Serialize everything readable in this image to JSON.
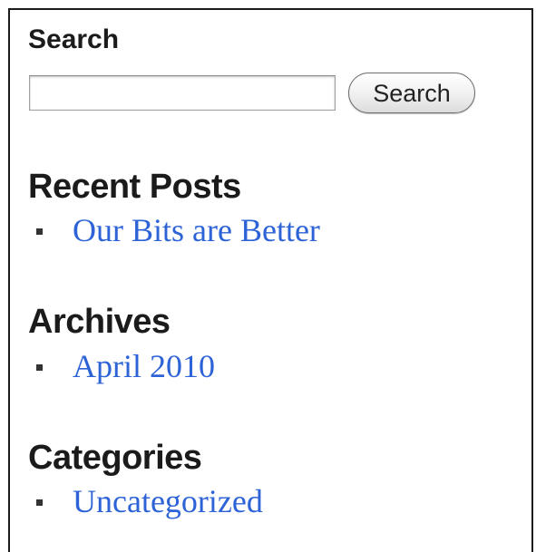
{
  "search": {
    "title": "Search",
    "input_value": "",
    "button_label": "Search"
  },
  "recent_posts": {
    "title": "Recent Posts",
    "items": [
      {
        "label": "Our Bits are Better"
      }
    ]
  },
  "archives": {
    "title": "Archives",
    "items": [
      {
        "label": "April 2010"
      }
    ]
  },
  "categories": {
    "title": "Categories",
    "items": [
      {
        "label": "Uncategorized"
      }
    ]
  },
  "colors": {
    "heading": "#1b1b1b",
    "link": "#2d63d6",
    "border": "#1b1b1b"
  }
}
